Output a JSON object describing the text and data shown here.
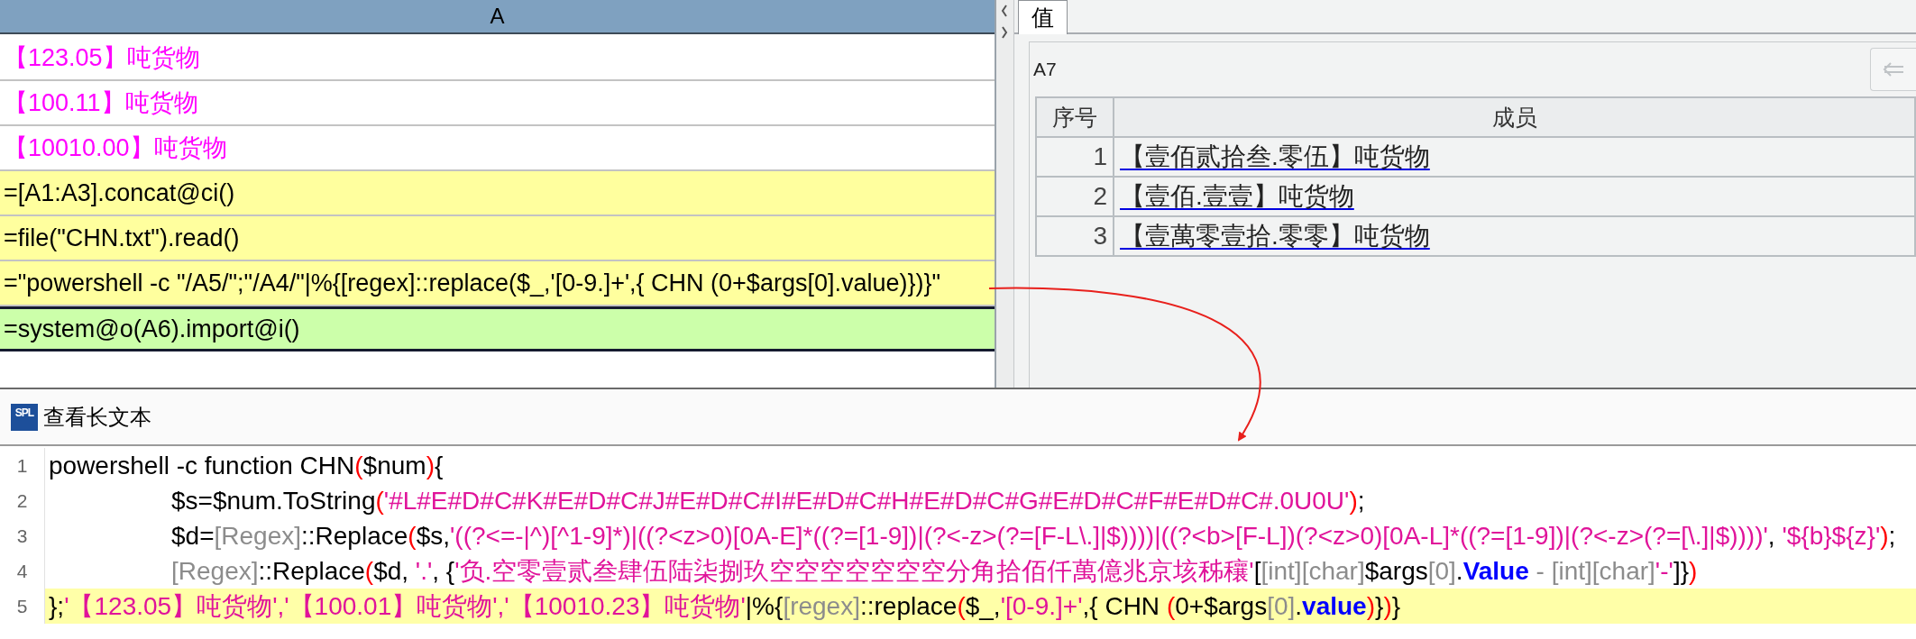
{
  "sheet": {
    "column_header": "A",
    "cells": [
      {
        "kind": "constant",
        "text": "【123.05】吨货物",
        "selected": false
      },
      {
        "kind": "constant",
        "text": "【100.11】吨货物",
        "selected": false
      },
      {
        "kind": "constant",
        "text": "【10010.00】吨货物",
        "selected": false
      },
      {
        "kind": "formula",
        "text": "=[A1:A3].concat@ci()",
        "selected": false
      },
      {
        "kind": "formula",
        "text": "=file(\"CHN.txt\").read()",
        "selected": false
      },
      {
        "kind": "formula",
        "text": "=\"powershell -c \"/A5/\";\"/A4/\"|%{[regex]::replace($_,'[0-9.]+',{ CHN (0+$args[0].value)})}\"",
        "selected": false
      },
      {
        "kind": "formula",
        "text": "=system@o(A6).import@i()",
        "selected": true
      }
    ]
  },
  "value_panel": {
    "tabs": [
      {
        "label": "值",
        "selected": true
      }
    ],
    "cell_ref": "A7",
    "table": {
      "columns": [
        "序号",
        "成员"
      ],
      "rows": [
        {
          "index": "1",
          "member": "【壹佰贰拾叁.零伍】吨货物"
        },
        {
          "index": "2",
          "member": "【壹佰.壹壹】吨货物"
        },
        {
          "index": "3",
          "member": "【壹萬零壹拾.零零】吨货物"
        }
      ]
    }
  },
  "long_text_viewer": {
    "logo_text": "SPL",
    "title": "查看长文本",
    "lines": [
      {
        "number": "1",
        "indented": false,
        "highlighted": false,
        "tokens": [
          {
            "kind": "text",
            "text": "powershell -c function CHN"
          },
          {
            "kind": "paren",
            "text": "("
          },
          {
            "kind": "text",
            "text": "$num"
          },
          {
            "kind": "paren",
            "text": ")"
          },
          {
            "kind": "text",
            "text": "{"
          }
        ]
      },
      {
        "number": "2",
        "indented": true,
        "highlighted": false,
        "tokens": [
          {
            "kind": "text",
            "text": "$s=$num.ToString"
          },
          {
            "kind": "paren",
            "text": "("
          },
          {
            "kind": "string",
            "text": "'#L#E#D#C#K#E#D#C#J#E#D#C#I#E#D#C#H#E#D#C#G#E#D#C#F#E#D#C#.0U0U'"
          },
          {
            "kind": "paren",
            "text": ")"
          },
          {
            "kind": "text",
            "text": ";"
          }
        ]
      },
      {
        "number": "3",
        "indented": true,
        "highlighted": false,
        "tokens": [
          {
            "kind": "text",
            "text": "$d="
          },
          {
            "kind": "type",
            "text": "[Regex]"
          },
          {
            "kind": "text",
            "text": "::Replace"
          },
          {
            "kind": "paren",
            "text": "("
          },
          {
            "kind": "text",
            "text": "$s,"
          },
          {
            "kind": "string",
            "text": "'((?<=-|^)[^1-9]*)|((?<z>0)[0A-E]*((?=[1-9])|(?<-z>(?=[F-L\\.]|$))))|((?<b>[F-L])(?<z>0)[0A-L]*((?=[1-9])|(?<-z>(?=[\\.]|$))))'"
          },
          {
            "kind": "text",
            "text": ", "
          },
          {
            "kind": "string",
            "text": "'${b}${z}'"
          },
          {
            "kind": "paren",
            "text": ")"
          },
          {
            "kind": "text",
            "text": ";"
          }
        ]
      },
      {
        "number": "4",
        "indented": true,
        "highlighted": false,
        "tokens": [
          {
            "kind": "type",
            "text": "[Regex]"
          },
          {
            "kind": "text",
            "text": "::Replace"
          },
          {
            "kind": "paren",
            "text": "("
          },
          {
            "kind": "text",
            "text": "$d, "
          },
          {
            "kind": "string",
            "text": "'.'"
          },
          {
            "kind": "text",
            "text": ", {"
          },
          {
            "kind": "string",
            "text": "'负.空零壹贰叁肆伍陆柒捌玖空空空空空空空分角拾佰仟萬億兆京垓秭穰'"
          },
          {
            "kind": "text",
            "text": "["
          },
          {
            "kind": "type",
            "text": "[int][char]"
          },
          {
            "kind": "text",
            "text": "$args"
          },
          {
            "kind": "type",
            "text": "[0]"
          },
          {
            "kind": "text",
            "text": "."
          },
          {
            "kind": "keyword",
            "text": "Value"
          },
          {
            "kind": "type",
            "text": " - [int][char]"
          },
          {
            "kind": "string",
            "text": "'-'"
          },
          {
            "kind": "text",
            "text": "]}"
          },
          {
            "kind": "paren",
            "text": ")"
          }
        ]
      },
      {
        "number": "5",
        "indented": false,
        "highlighted": true,
        "tokens": [
          {
            "kind": "text",
            "text": "};"
          },
          {
            "kind": "string",
            "text": "'【123.05】吨货物','【100.01】吨货物','【10010.23】吨货物'"
          },
          {
            "kind": "text",
            "text": "|%{"
          },
          {
            "kind": "type",
            "text": "[regex]"
          },
          {
            "kind": "text",
            "text": "::replace"
          },
          {
            "kind": "paren",
            "text": "("
          },
          {
            "kind": "text",
            "text": "$_,"
          },
          {
            "kind": "string",
            "text": "'[0-9.]+'"
          },
          {
            "kind": "text",
            "text": ",{ CHN "
          },
          {
            "kind": "paren",
            "text": "("
          },
          {
            "kind": "text",
            "text": "0+$args"
          },
          {
            "kind": "type",
            "text": "[0]"
          },
          {
            "kind": "text",
            "text": "."
          },
          {
            "kind": "keyword",
            "text": "value"
          },
          {
            "kind": "paren",
            "text": ")"
          },
          {
            "kind": "text",
            "text": "}"
          },
          {
            "kind": "paren",
            "text": ")"
          },
          {
            "kind": "text",
            "text": "}"
          }
        ]
      }
    ]
  }
}
